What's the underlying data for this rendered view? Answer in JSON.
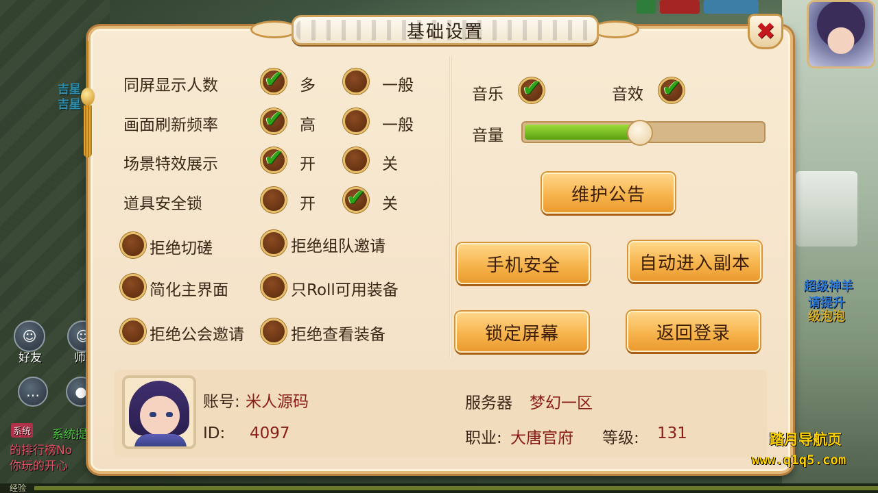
{
  "dialog": {
    "title": "基础设置",
    "close_icon": "close-icon"
  },
  "display_settings": [
    {
      "label": "同屏显示人数",
      "options": [
        {
          "label": "多",
          "selected": true
        },
        {
          "label": "一般",
          "selected": false
        }
      ]
    },
    {
      "label": "画面刷新频率",
      "options": [
        {
          "label": "高",
          "selected": true
        },
        {
          "label": "一般",
          "selected": false
        }
      ]
    },
    {
      "label": "场景特效展示",
      "options": [
        {
          "label": "开",
          "selected": true
        },
        {
          "label": "关",
          "selected": false
        }
      ]
    },
    {
      "label": "道具安全锁",
      "options": [
        {
          "label": "开",
          "selected": false
        },
        {
          "label": "关",
          "selected": true
        }
      ]
    }
  ],
  "toggles": [
    {
      "label": "拒绝切磋",
      "checked": false
    },
    {
      "label": "拒绝组队邀请",
      "checked": false
    },
    {
      "label": "简化主界面",
      "checked": false
    },
    {
      "label": "只Roll可用装备",
      "checked": false
    },
    {
      "label": "拒绝公会邀请",
      "checked": false
    },
    {
      "label": "拒绝查看装备",
      "checked": false
    }
  ],
  "audio": {
    "music_label": "音乐",
    "music_on": true,
    "sfx_label": "音效",
    "sfx_on": true,
    "volume_label": "音量",
    "volume_fraction": 0.48
  },
  "buttons": {
    "maintenance": "维护公告",
    "phone_security": "手机安全",
    "auto_dungeon": "自动进入副本",
    "lock_screen": "锁定屏幕",
    "back_to_login": "返回登录"
  },
  "account": {
    "account_label": "账号:",
    "account_value": "米人源码",
    "id_label": "ID:",
    "id_value": "4097",
    "server_label": "服务器",
    "server_value": "梦幻一区",
    "class_label": "职业:",
    "class_value": "大唐官府",
    "level_label": "等级:",
    "level_value": "131"
  },
  "background_hud": {
    "left_name": "吉星",
    "left_name_2": "吉星",
    "friends_label": "好友",
    "mentor_label": "师徒",
    "system_tag": "系统",
    "chat_line_1": "系统提",
    "chat_line_2": "的排行榜No",
    "chat_line_3": "你玩的开心",
    "right_text_1": "超级神羊",
    "right_text_2": "请提升",
    "right_text_3": "级泡泡",
    "bottom_label": "经验"
  },
  "watermark": {
    "line1": "踏月导航页",
    "line2": "www.q1q5.com"
  },
  "colors": {
    "panel_bg": "#f8ead3",
    "panel_border": "#e3b876",
    "check_green": "#2ea316",
    "button_orange": "#f7b44d",
    "value_red": "#8a1e16"
  }
}
